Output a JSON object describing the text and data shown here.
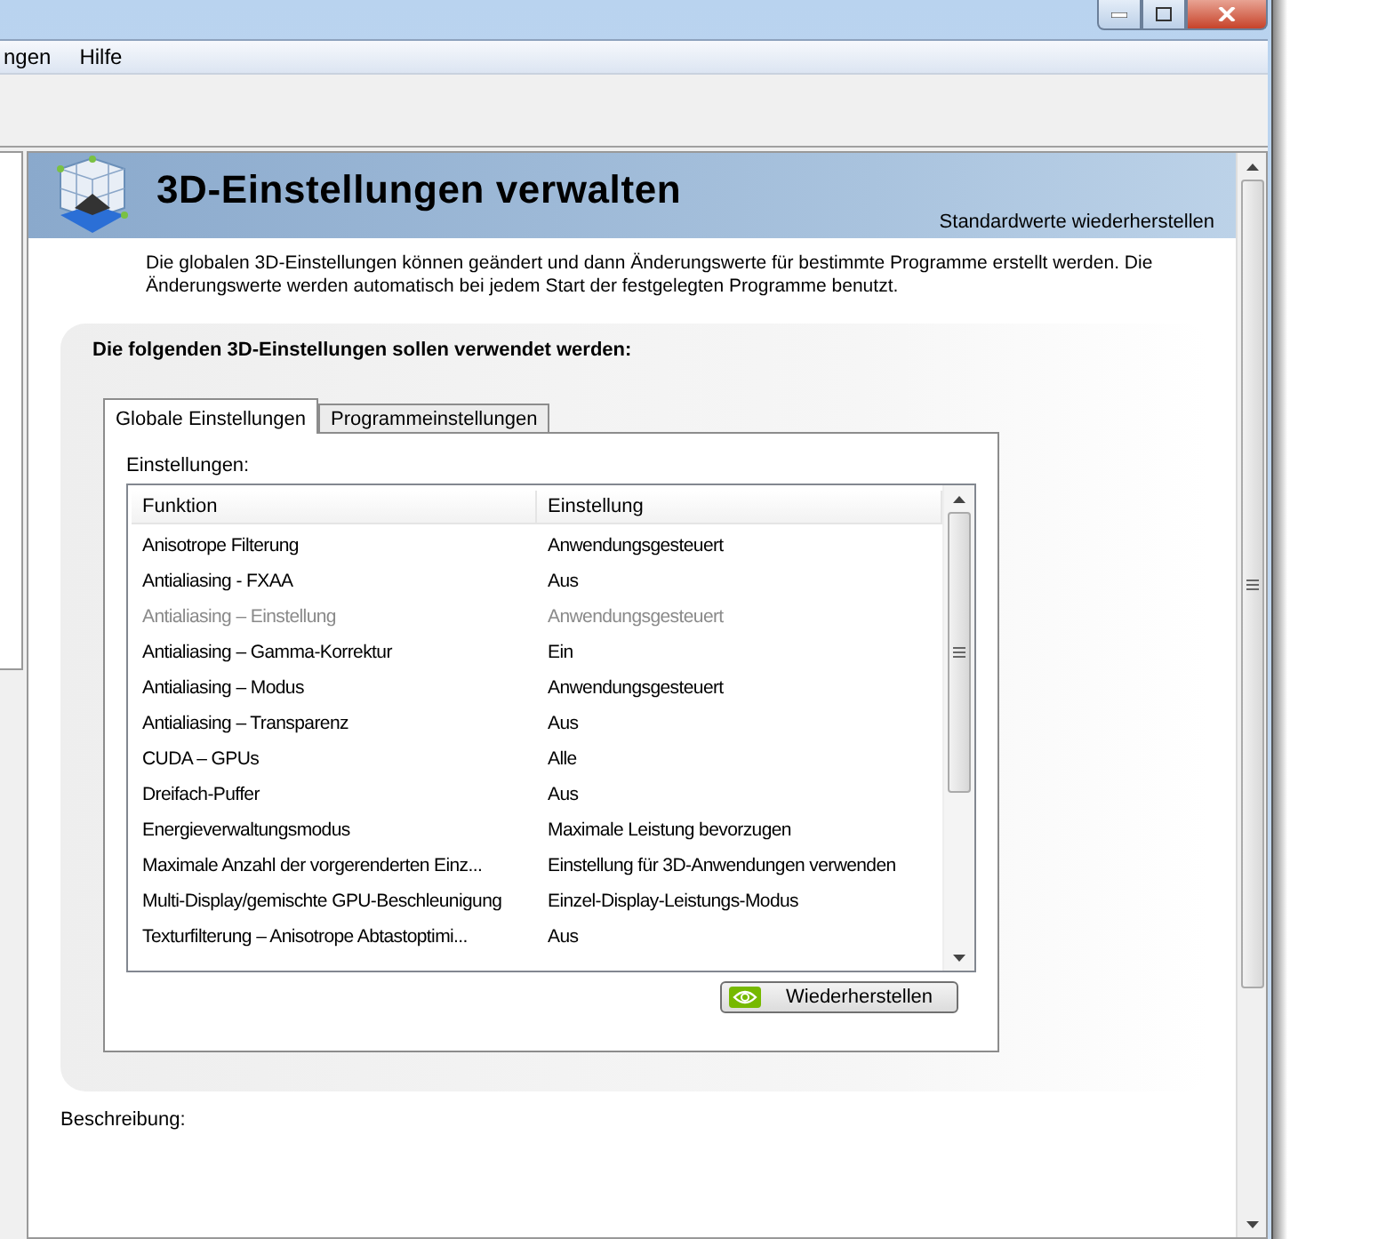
{
  "menu_bar": {
    "items": [
      "ngen",
      "Hilfe"
    ]
  },
  "header": {
    "title": "3D-Einstellungen verwalten",
    "restore_link": "Standardwerte wiederherstellen"
  },
  "description": "Die globalen 3D-Einstellungen können geändert und dann Änderungswerte für bestimmte Programme erstellt werden. Die Änderungswerte werden automatisch bei jedem Start der festgelegten Programme benutzt.",
  "settings_group": {
    "heading": "Die folgenden 3D-Einstellungen sollen verwendet werden:",
    "tabs": [
      {
        "label": "Globale Einstellungen",
        "selected": true
      },
      {
        "label": "Programmeinstellungen",
        "selected": false
      }
    ],
    "list_label": "Einstellungen:",
    "table": {
      "columns": [
        "Funktion",
        "Einstellung"
      ],
      "rows": [
        {
          "function": "Anisotrope Filterung",
          "setting": "Anwendungsgesteuert",
          "disabled": false
        },
        {
          "function": "Antialiasing - FXAA",
          "setting": "Aus",
          "disabled": false
        },
        {
          "function": "Antialiasing – Einstellung",
          "setting": "Anwendungsgesteuert",
          "disabled": true
        },
        {
          "function": "Antialiasing – Gamma-Korrektur",
          "setting": "Ein",
          "disabled": false
        },
        {
          "function": "Antialiasing – Modus",
          "setting": "Anwendungsgesteuert",
          "disabled": false
        },
        {
          "function": "Antialiasing – Transparenz",
          "setting": "Aus",
          "disabled": false
        },
        {
          "function": "CUDA – GPUs",
          "setting": "Alle",
          "disabled": false
        },
        {
          "function": "Dreifach-Puffer",
          "setting": "Aus",
          "disabled": false
        },
        {
          "function": "Energieverwaltungsmodus",
          "setting": "Maximale Leistung bevorzugen",
          "disabled": false
        },
        {
          "function": "Maximale Anzahl der vorgerenderten Einz...",
          "setting": "Einstellung für 3D-Anwendungen verwenden",
          "disabled": false
        },
        {
          "function": "Multi-Display/gemischte GPU-Beschleunigung",
          "setting": "Einzel-Display-Leistungs-Modus",
          "disabled": false
        },
        {
          "function": "Texturfilterung – Anisotrope Abtastoptimi...",
          "setting": "Aus",
          "disabled": false
        }
      ]
    },
    "restore_button": "Wiederherstellen"
  },
  "description_label": "Beschreibung:"
}
